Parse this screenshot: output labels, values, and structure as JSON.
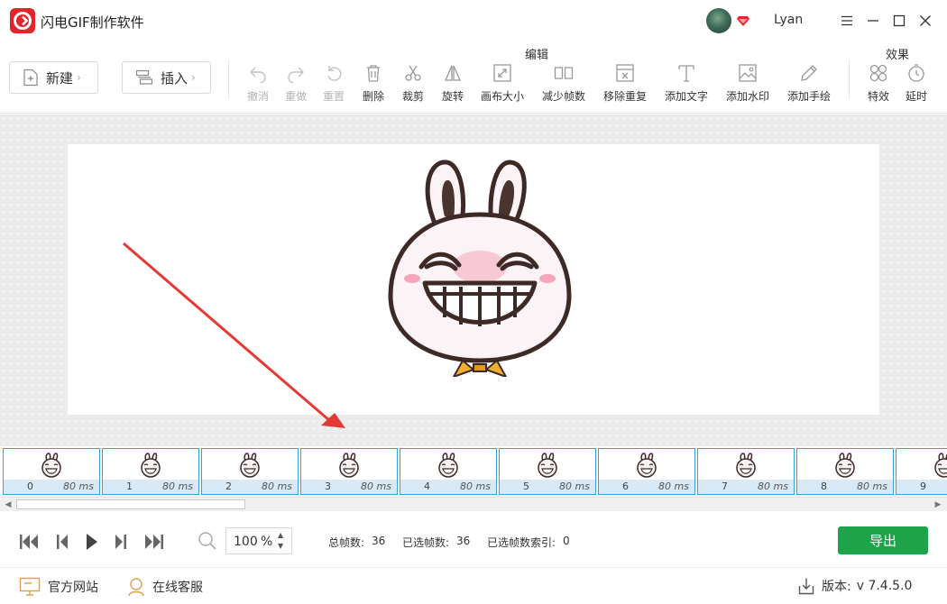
{
  "app": {
    "title": "闪电GIF制作软件"
  },
  "user": {
    "name": "Lyan"
  },
  "toolbar": {
    "new_label": "新建",
    "insert_label": "插入",
    "edit_group_label": "编辑",
    "effects_group_label": "效果",
    "tools": [
      {
        "label": "撤消",
        "icon": "undo-icon",
        "enabled": false
      },
      {
        "label": "重做",
        "icon": "redo-icon",
        "enabled": false
      },
      {
        "label": "重置",
        "icon": "reset-icon",
        "enabled": false
      },
      {
        "label": "删除",
        "icon": "trash-icon",
        "enabled": true
      },
      {
        "label": "裁剪",
        "icon": "scissors-icon",
        "enabled": true
      },
      {
        "label": "旋转",
        "icon": "rotate-icon",
        "enabled": true
      },
      {
        "label": "画布大小",
        "icon": "canvas-size-icon",
        "enabled": true
      },
      {
        "label": "减少帧数",
        "icon": "reduce-frames-icon",
        "enabled": true
      },
      {
        "label": "移除重复",
        "icon": "remove-duplicates-icon",
        "enabled": true
      },
      {
        "label": "添加文字",
        "icon": "text-icon",
        "enabled": true
      },
      {
        "label": "添加水印",
        "icon": "watermark-icon",
        "enabled": true
      },
      {
        "label": "添加手绘",
        "icon": "pen-icon",
        "enabled": true
      },
      {
        "label": "特效",
        "icon": "effects-icon",
        "enabled": true
      },
      {
        "label": "延时",
        "icon": "timer-icon",
        "enabled": true
      }
    ]
  },
  "frames": [
    {
      "index": "0",
      "duration": "80 ms"
    },
    {
      "index": "1",
      "duration": "80 ms"
    },
    {
      "index": "2",
      "duration": "80 ms"
    },
    {
      "index": "3",
      "duration": "80 ms"
    },
    {
      "index": "4",
      "duration": "80 ms"
    },
    {
      "index": "5",
      "duration": "80 ms"
    },
    {
      "index": "6",
      "duration": "80 ms"
    },
    {
      "index": "7",
      "duration": "80 ms"
    },
    {
      "index": "8",
      "duration": "80 ms"
    },
    {
      "index": "9",
      "duration": ""
    }
  ],
  "playback": {
    "zoom_value": "100",
    "zoom_unit": "%",
    "total_frames_label": "总帧数:",
    "total_frames": "36",
    "selected_frames_label": "已选帧数:",
    "selected_frames": "36",
    "selected_index_label": "已选帧数索引:",
    "selected_index": "0",
    "export_label": "导出"
  },
  "footer": {
    "website_label": "官方网站",
    "support_label": "在线客服",
    "version_label": "版本:",
    "version_value": "v 7.4.5.0"
  },
  "colors": {
    "brand": "#e0262b",
    "export": "#1ea34a",
    "frame_border": "#3aa0d8",
    "annotation_arrow": "#e53935"
  }
}
